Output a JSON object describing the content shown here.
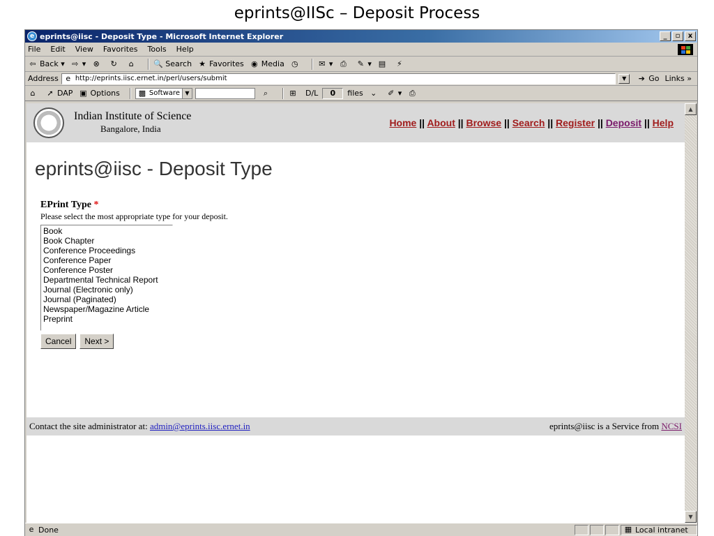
{
  "slide_title": "eprints@IISc – Deposit Process",
  "window": {
    "title": "eprints@iisc - Deposit Type - Microsoft Internet Explorer"
  },
  "menu": [
    "File",
    "Edit",
    "View",
    "Favorites",
    "Tools",
    "Help"
  ],
  "toolbar": {
    "back": "Back",
    "search": "Search",
    "favorites": "Favorites",
    "media": "Media"
  },
  "address": {
    "label": "Address",
    "url": "http://eprints.iisc.ernet.in/perl/users/submit",
    "go": "Go",
    "links": "Links"
  },
  "links_bar": {
    "dap": "DAP",
    "options": "Options",
    "software": "Software",
    "dl": "D/L",
    "count": "0",
    "files": "files"
  },
  "site": {
    "inst_name": "Indian Institute of Science",
    "inst_loc": "Bangalore, India",
    "nav": [
      "Home",
      "About",
      "Browse",
      "Search",
      "Register",
      "Deposit",
      "Help"
    ]
  },
  "page": {
    "heading": "eprints@iisc - Deposit Type",
    "field_label": "EPrint Type",
    "required_mark": "*",
    "field_help": "Please select the most appropriate type for your deposit.",
    "types": [
      "Book",
      "Book Chapter",
      "Conference Proceedings",
      "Conference Paper",
      "Conference Poster",
      "Departmental Technical Report",
      "Journal (Electronic only)",
      "Journal (Paginated)",
      "Newspaper/Magazine Article",
      "Preprint"
    ],
    "cancel": "Cancel",
    "next": "Next >"
  },
  "footer": {
    "contact": "Contact the site administrator at:",
    "email": "admin@eprints.iisc.ernet.in",
    "service": "eprints@iisc is a Service from",
    "ncsi": "NCSI"
  },
  "status": {
    "text": "Done",
    "zone": "Local intranet"
  }
}
